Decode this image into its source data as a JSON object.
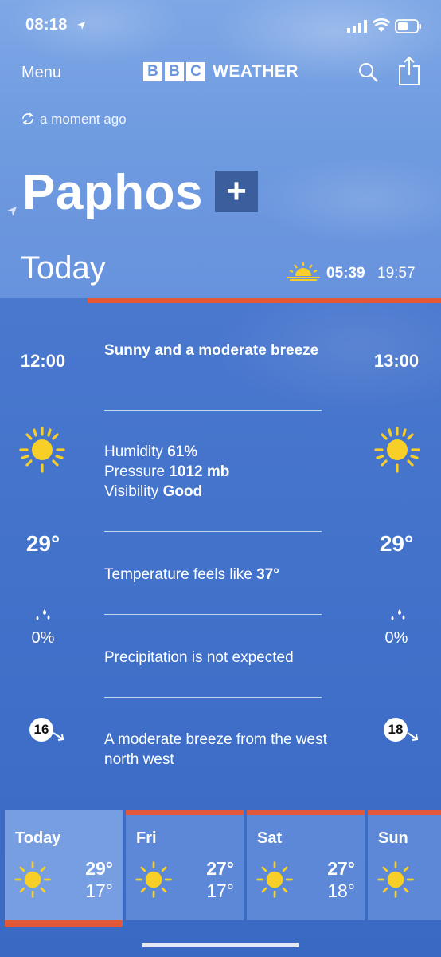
{
  "status_bar": {
    "time": "08:18"
  },
  "header": {
    "menu_label": "Menu",
    "logo_letters": [
      "B",
      "B",
      "C"
    ],
    "logo_word": "WEATHER"
  },
  "updated": "a moment ago",
  "location": {
    "city": "Paphos",
    "add_label": "+"
  },
  "today": {
    "label": "Today",
    "sunrise": "05:39",
    "sunset": "19:57"
  },
  "detail": {
    "left_hour": "12:00",
    "right_hour": "13:00",
    "summary": "Sunny and a moderate breeze",
    "humidity_label": "Humidity",
    "humidity_value": "61%",
    "pressure_label": "Pressure",
    "pressure_value": "1012 mb",
    "visibility_label": "Visibility",
    "visibility_value": "Good",
    "left_temp": "29°",
    "right_temp": "29°",
    "feels_label": "Temperature feels like",
    "feels_value": "37°",
    "left_precip": "0%",
    "right_precip": "0%",
    "precip_text": "Precipitation is not expected",
    "left_wind": "16",
    "right_wind": "18",
    "wind_text": "A moderate breeze from the west north west",
    "weather_icon": "sun-icon"
  },
  "forecast": [
    {
      "day": "Today",
      "high": "29°",
      "low": "17°",
      "icon": "sun-icon"
    },
    {
      "day": "Fri",
      "high": "27°",
      "low": "17°",
      "icon": "sun-icon"
    },
    {
      "day": "Sat",
      "high": "27°",
      "low": "18°",
      "icon": "sun-icon"
    },
    {
      "day": "Sun",
      "high": "",
      "low": "",
      "icon": "sun-icon"
    }
  ],
  "colors": {
    "accent": "#e4583a",
    "sun": "#f7cf27",
    "add_button": "#3b5f9c"
  }
}
